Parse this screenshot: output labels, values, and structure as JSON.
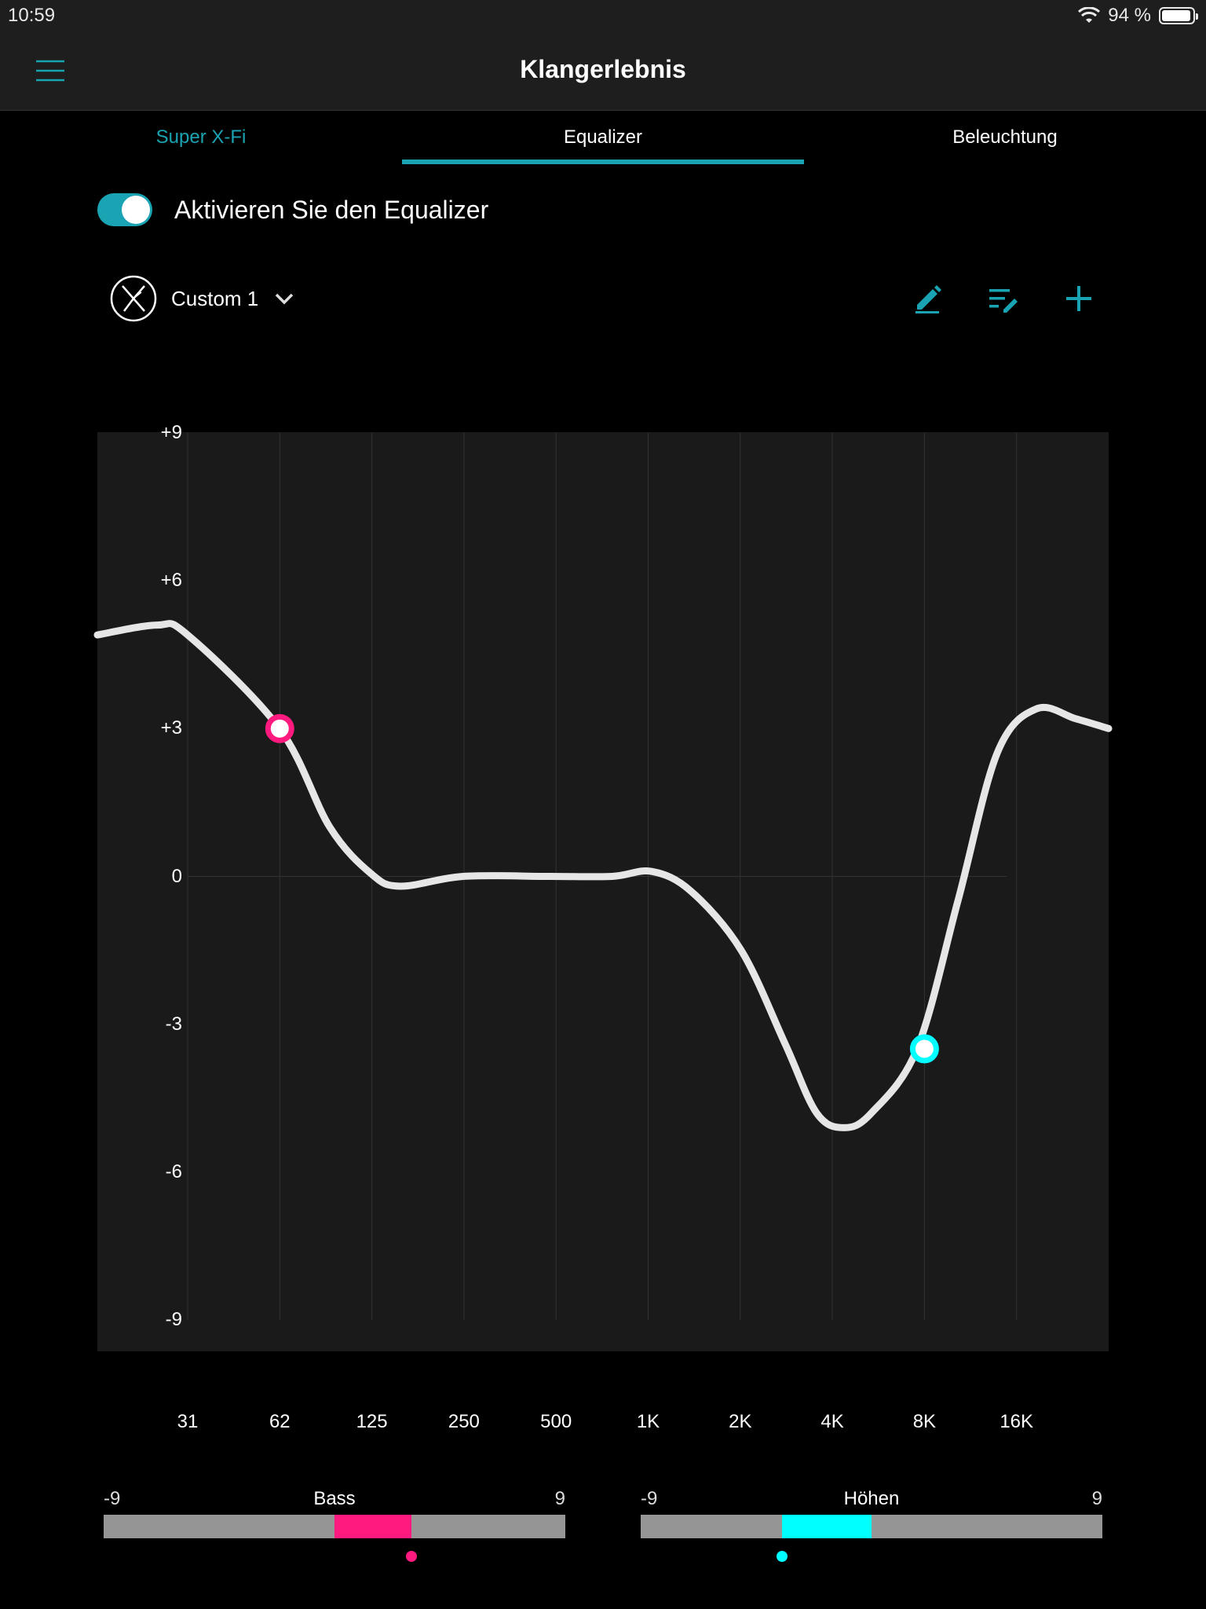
{
  "status": {
    "time": "10:59",
    "battery": "94 %",
    "battery_level": 0.94
  },
  "nav": {
    "title": "Klangerlebnis",
    "menu_icon": "hamburger-menu-icon"
  },
  "tabs": [
    {
      "label": "Super X-Fi",
      "active": false
    },
    {
      "label": "Equalizer",
      "active": true
    },
    {
      "label": "Beleuchtung",
      "active": false
    }
  ],
  "toggle": {
    "label": "Aktivieren Sie den Equalizer",
    "on": true
  },
  "preset": {
    "name": "Custom 1",
    "icon": "super-x-fi-logo-icon"
  },
  "toolbar": {
    "icons": [
      "edit-icon",
      "list-edit-icon",
      "add-icon"
    ]
  },
  "equalizer": {
    "y_ticks": [
      "+9",
      "+6",
      "+3",
      "0",
      "-3",
      "-6",
      "-9"
    ],
    "bands": [
      "31",
      "62",
      "125",
      "250",
      "500",
      "1K",
      "2K",
      "4K",
      "8K",
      "16K"
    ],
    "bass_handle": {
      "band": "62",
      "gain": 3
    },
    "treble_handle": {
      "band": "8K",
      "gain": -3.5
    }
  },
  "sliders": {
    "bass": {
      "title": "Bass",
      "min": "-9",
      "max": "9",
      "value": 3,
      "color": "#ff1a7f"
    },
    "treble": {
      "title": "Höhen",
      "min": "-9",
      "max": "9",
      "value": -3.5,
      "color": "#00ffff"
    }
  },
  "colors": {
    "accent": "#1aa3b2",
    "bass": "#ff1a7f",
    "treble": "#00ffff",
    "curve": "#e6e6e6"
  }
}
